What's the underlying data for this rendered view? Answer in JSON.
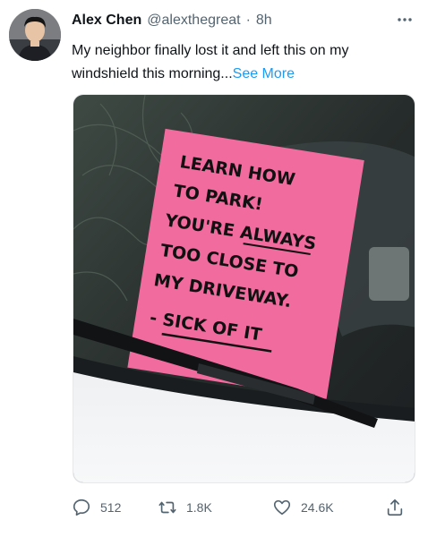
{
  "tweet": {
    "author_name": "Alex Chen",
    "handle": "@alexthegreat",
    "separator": "·",
    "time": "8h",
    "text": "My neighbor finally lost it and left this on my windshield this morning...",
    "see_more": "See More",
    "note_lines": [
      "LEARN HOW",
      "TO PARK!",
      "YOU'RE ALWAYS",
      "TOO CLOSE TO",
      "MY DRIVEWAY.",
      "- SICK OF IT"
    ],
    "replies": "512",
    "retweets": "1.8K",
    "likes": "24.6K"
  },
  "icons": {
    "more": "more-horizontal-icon",
    "reply": "reply-icon",
    "retweet": "retweet-icon",
    "like": "heart-icon",
    "share": "share-icon"
  },
  "colors": {
    "link": "#1d9bf0",
    "secondary_text": "#536471",
    "note_pink": "#f26b9e"
  }
}
